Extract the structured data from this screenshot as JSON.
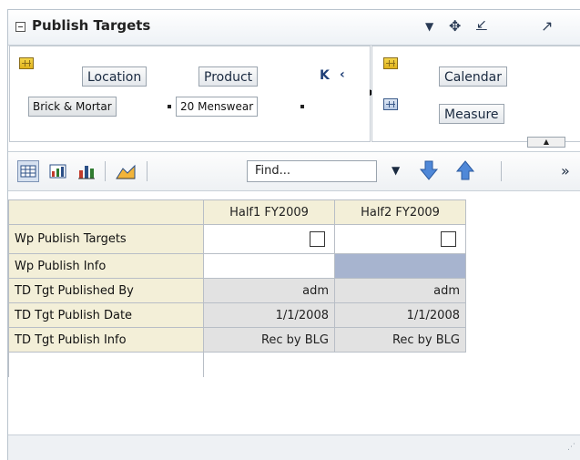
{
  "panel": {
    "title": "Publish Targets"
  },
  "pivot": {
    "row_dimensions": [
      "Location",
      "Product"
    ],
    "row_selections": [
      "Brick & Mortar",
      "20 Menswear"
    ],
    "column_dimensions": [
      "Calendar",
      "Measure"
    ]
  },
  "toolbar": {
    "find_placeholder": "Find..."
  },
  "table": {
    "columns": [
      "Half1 FY2009",
      "Half2 FY2009"
    ],
    "rows": [
      {
        "label": "Wp Publish Targets",
        "cells": [
          "",
          ""
        ]
      },
      {
        "label": "Wp Publish Info",
        "cells": [
          "",
          ""
        ]
      },
      {
        "label": "TD Tgt Published By",
        "cells": [
          "adm",
          "adm"
        ]
      },
      {
        "label": "TD Tgt Publish Date",
        "cells": [
          "1/1/2008",
          "1/1/2008"
        ]
      },
      {
        "label": "TD Tgt Publish Info",
        "cells": [
          "Rec by BLG",
          "Rec by BLG"
        ]
      }
    ]
  },
  "colors": {
    "header_bg": "#f3efd8",
    "readonly_bg": "#e2e2e2",
    "selected_bg": "#a7b4cf"
  }
}
